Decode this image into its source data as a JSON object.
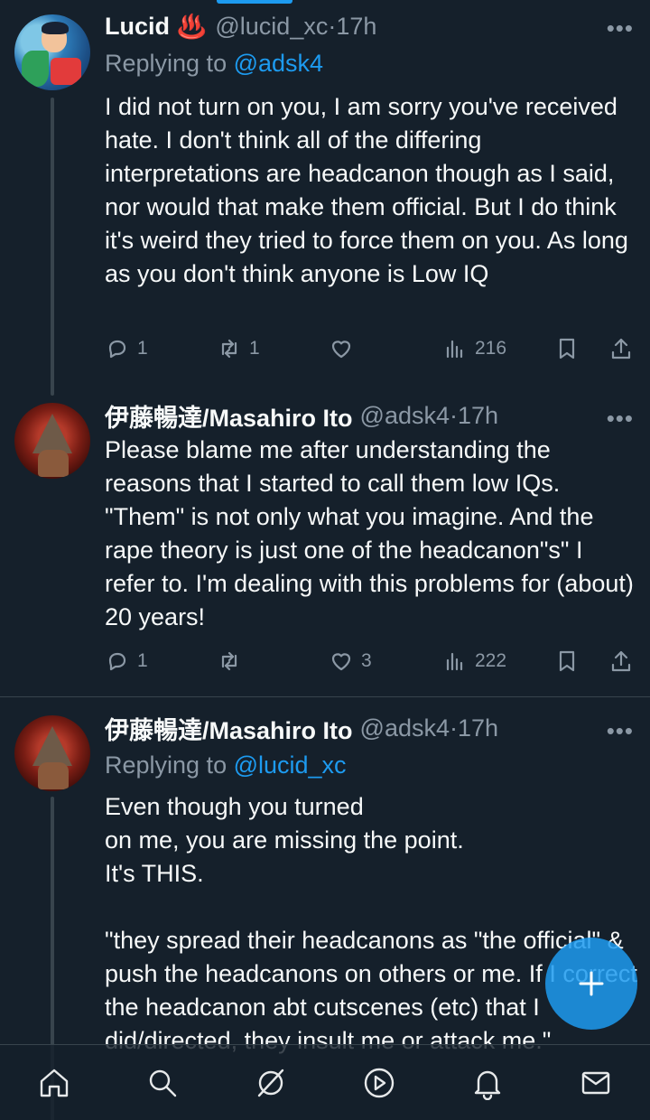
{
  "tweets": [
    {
      "name": "Lucid",
      "emoji": "♨️",
      "handle": "@lucid_xc",
      "time": "17h",
      "replying_prefix": "Replying to ",
      "replying_to": "@adsk4",
      "text": "I did not turn on you, I am sorry you've received hate. I don't think all of the differing interpretations are headcanon though as I said, nor would that make them official. But I do think it's weird they tried to force them on you. As long as you don't think anyone is Low IQ",
      "replies": "1",
      "reposts": "1",
      "likes": "",
      "views": "216"
    },
    {
      "name": "伊藤暢達/Masahiro Ito",
      "handle": "@adsk4",
      "time": "17h",
      "text": "Please blame me after understanding the reasons that I started to call them low IQs. \"Them\" is not only what you imagine. And the rape theory is just one of the headcanon\"s\" I refer to. I'm dealing with this problems for (about) 20 years!",
      "replies": "1",
      "reposts": "",
      "likes": "3",
      "views": "222"
    },
    {
      "name": "伊藤暢達/Masahiro Ito",
      "handle": "@adsk4",
      "time": "17h",
      "replying_prefix": "Replying to ",
      "replying_to": "@lucid_xc",
      "text": "Even though you turned\non me, you are missing the point.\nIt's THIS.\n\n\"they spread their headcanons as \"the official\" & push the headcanons on others or me. If I correct the headcanon abt cutscenes (etc) that I did/directed, they insult me or attack me.\""
    }
  ],
  "separator": " · ",
  "more_glyph": "•••",
  "colors": {
    "background": "#15202b",
    "accent": "#1d9bf0",
    "secondary_text": "#8b98a5",
    "divider": "#38444d"
  },
  "icons": {
    "reply": "reply-icon",
    "repost": "repost-icon",
    "like": "heart-icon",
    "views": "views-icon",
    "bookmark": "bookmark-icon",
    "share": "share-icon",
    "compose": "plus-icon"
  },
  "nav": [
    "home-icon",
    "search-icon",
    "grok-icon",
    "video-icon",
    "notifications-icon",
    "messages-icon"
  ]
}
